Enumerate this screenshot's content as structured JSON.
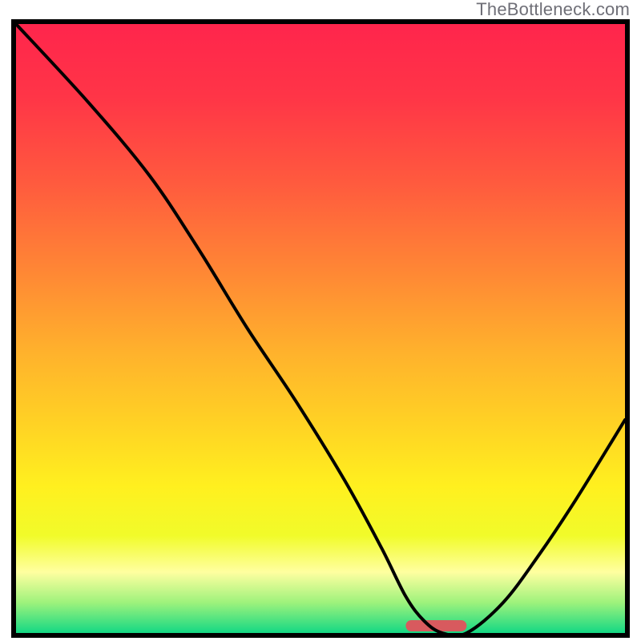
{
  "attribution": "TheBottleneck.com",
  "chart_data": {
    "type": "line",
    "title": "",
    "xlabel": "",
    "ylabel": "",
    "xlim": [
      0,
      100
    ],
    "ylim": [
      0,
      100
    ],
    "x": [
      0,
      12,
      22,
      30,
      38,
      46,
      54,
      60,
      64,
      67,
      70,
      74,
      80,
      86,
      92,
      100
    ],
    "values": [
      100,
      87,
      75,
      63,
      50,
      38,
      25,
      14,
      6,
      2,
      0,
      0,
      5,
      13,
      22,
      35
    ],
    "series_name": "bottleneck-curve",
    "grid": false,
    "legend": false,
    "marker_range_x": [
      64,
      74
    ],
    "marker_color": "#d85a5e",
    "background_gradient": {
      "stops": [
        {
          "offset": 0.0,
          "color": "#ff254c"
        },
        {
          "offset": 0.12,
          "color": "#ff3547"
        },
        {
          "offset": 0.26,
          "color": "#ff5a3e"
        },
        {
          "offset": 0.4,
          "color": "#ff8535"
        },
        {
          "offset": 0.54,
          "color": "#ffb22c"
        },
        {
          "offset": 0.66,
          "color": "#ffd324"
        },
        {
          "offset": 0.76,
          "color": "#fff01f"
        },
        {
          "offset": 0.84,
          "color": "#f1fb2a"
        },
        {
          "offset": 0.9,
          "color": "#ffffa0"
        },
        {
          "offset": 0.95,
          "color": "#9ef27c"
        },
        {
          "offset": 1.0,
          "color": "#14d884"
        }
      ]
    }
  }
}
